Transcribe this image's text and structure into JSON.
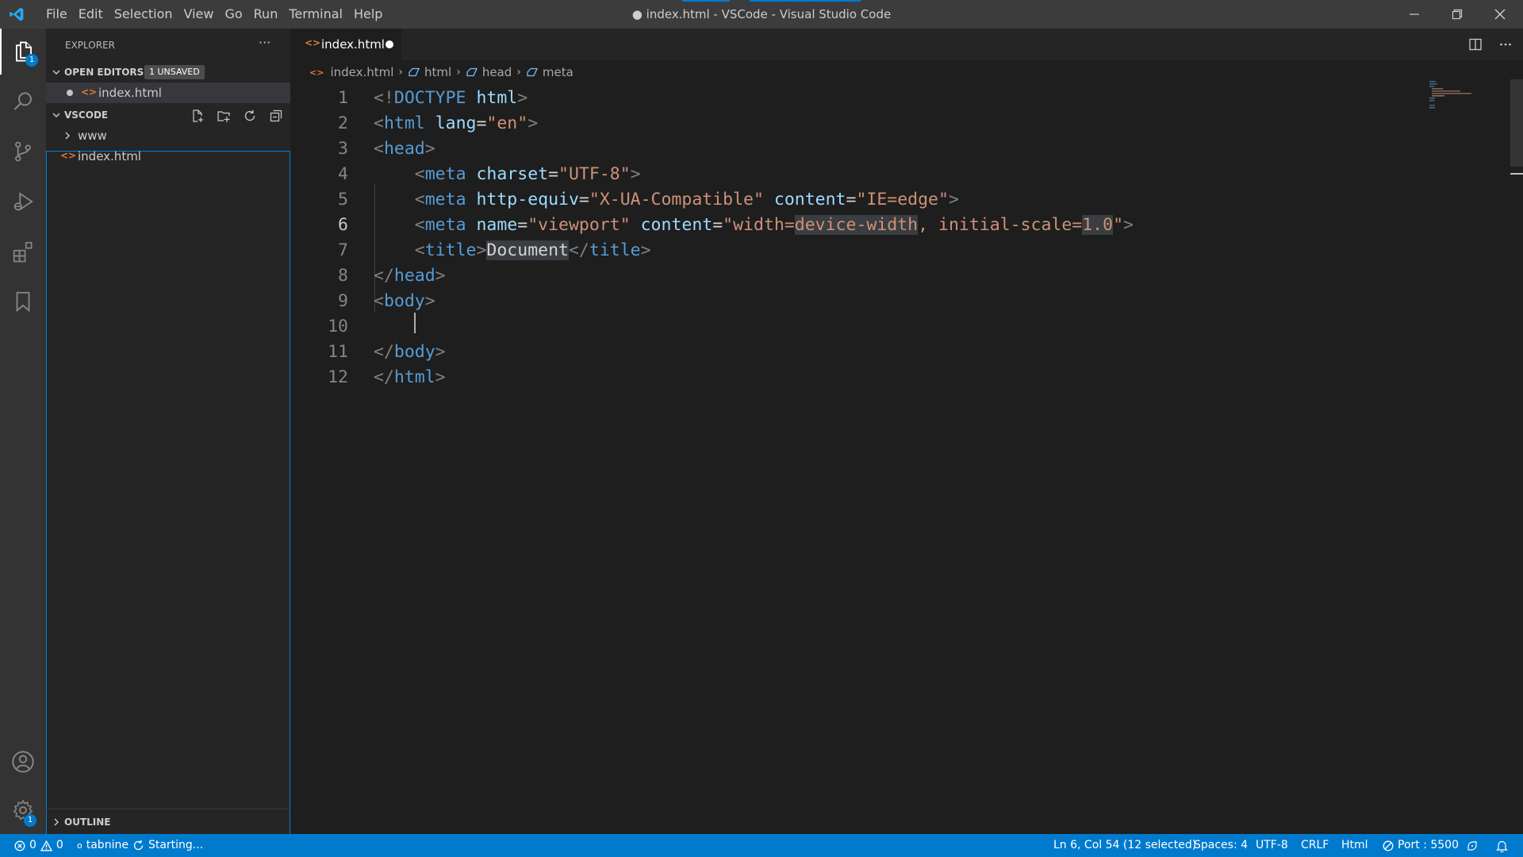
{
  "window": {
    "title": "● index.html - VSCode - Visual Studio Code",
    "menu": [
      "File",
      "Edit",
      "Selection",
      "View",
      "Go",
      "Run",
      "Terminal",
      "Help"
    ]
  },
  "activity_bar": {
    "explorer_badge": "1",
    "settings_badge": "1"
  },
  "sidebar": {
    "header": "EXPLORER",
    "more": "···",
    "open_editors": {
      "label": "OPEN EDITORS",
      "badge": "1 UNSAVED",
      "items": [
        {
          "name": "index.html",
          "dirty": true
        }
      ]
    },
    "folder": {
      "label": "VSCODE",
      "items": [
        {
          "name": "www",
          "type": "folder"
        },
        {
          "name": "index.html",
          "type": "file"
        }
      ]
    },
    "outline_label": "OUTLINE"
  },
  "editor": {
    "tab": {
      "label": "index.html",
      "dirty": true
    },
    "breadcrumb": [
      "index.html",
      "html",
      "head",
      "meta"
    ],
    "current_line": 6,
    "lines": [
      {
        "n": "1",
        "text": "<!DOCTYPE html>"
      },
      {
        "n": "2",
        "text": "<html lang=\"en\">"
      },
      {
        "n": "3",
        "text": "<head>"
      },
      {
        "n": "4",
        "text": "    <meta charset=\"UTF-8\">"
      },
      {
        "n": "5",
        "text": "    <meta http-equiv=\"X-UA-Compatible\" content=\"IE=edge\">"
      },
      {
        "n": "6",
        "text": "    <meta name=\"viewport\" content=\"width=device-width, initial-scale=1.0\">"
      },
      {
        "n": "7",
        "text": "    <title>Document</title>"
      },
      {
        "n": "8",
        "text": "</head>"
      },
      {
        "n": "9",
        "text": "<body>"
      },
      {
        "n": "10",
        "text": "    "
      },
      {
        "n": "11",
        "text": "</body>"
      },
      {
        "n": "12",
        "text": "</html>"
      }
    ],
    "tokens": {
      "l1": {
        "open": "<!",
        "tag": "DOCTYPE",
        "attr": "html",
        "close": ">"
      },
      "l2": {
        "open": "<",
        "tag": "html",
        "attr": "lang",
        "eq": "=",
        "val": "\"en\"",
        "close": ">"
      },
      "l3": {
        "open": "<",
        "tag": "head",
        "close": ">"
      },
      "l4": {
        "open": "<",
        "tag": "meta",
        "attr": "charset",
        "eq": "=",
        "val": "\"UTF-8\"",
        "close": ">"
      },
      "l5": {
        "open": "<",
        "tag": "meta",
        "attr1": "http-equiv",
        "eq": "=",
        "val1": "\"X-UA-Compatible\"",
        "attr2": "content",
        "val2": "\"IE=edge\"",
        "close": ">"
      },
      "l6": {
        "open": "<",
        "tag": "meta",
        "attr1": "name",
        "eq": "=",
        "val1": "\"viewport\"",
        "attr2": "content",
        "val2a": "\"width=",
        "val2b": "device-width",
        "val2c": ", initial-scale=",
        "val2d": "1.0",
        "val2e": "\"",
        "close": ">"
      },
      "l7": {
        "open": "<",
        "tag": "title",
        "close": ">",
        "text": "Document",
        "open2": "</",
        "tag2": "title"
      },
      "l8": {
        "open": "</",
        "tag": "head",
        "close": ">"
      },
      "l9": {
        "open": "<",
        "tag": "body",
        "close": ">"
      },
      "l11": {
        "open": "</",
        "tag": "body",
        "close": ">"
      },
      "l12": {
        "open": "</",
        "tag": "html",
        "close": ">"
      }
    }
  },
  "status_bar": {
    "errors": "0",
    "warnings": "0",
    "tabnine": "tabnine",
    "tabnine_status": "Starting...",
    "position": "Ln 6, Col 54 (12 selected)",
    "spaces": "Spaces: 4",
    "encoding": "UTF-8",
    "eol": "CRLF",
    "language": "Html",
    "port": "Port : 5500"
  },
  "colors": {
    "accent": "#007acc",
    "tag": "#569cd6",
    "attribute": "#9cdcfe",
    "string": "#ce9178",
    "html_file_icon": "#e37933"
  }
}
